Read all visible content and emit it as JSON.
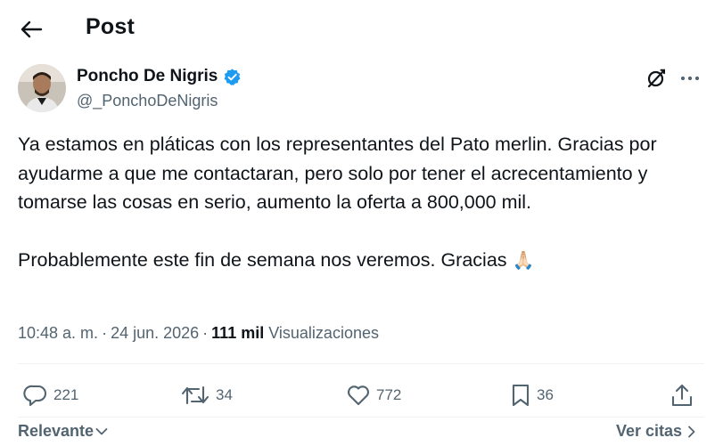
{
  "header": {
    "title": "Post",
    "back_icon": "arrow-left-icon"
  },
  "author": {
    "display_name": "Poncho De Nigris",
    "handle": "@_PonchoDeNigris",
    "verified_color": "#1d9bf0",
    "verified_icon": "verified-badge-icon"
  },
  "post": {
    "paragraph1": "Ya estamos en pláticas con los representantes del Pato merlin. Gracias por ayudarme a que me contactaran, pero solo por tener el acrecentamiento y tomarse las cosas en serio, aumento la oferta a 800,000 mil.",
    "paragraph2": "Probablemente este fin de semana nos veremos. Gracias",
    "emoji": "🙏🏻"
  },
  "meta": {
    "time": "10:48 a. m.",
    "date": "24 jun. 2026",
    "views_count": "111 mil",
    "views_label": "Visualizaciones"
  },
  "actions": {
    "replies": "221",
    "reposts": "34",
    "likes": "772",
    "bookmarks": "36"
  },
  "footer": {
    "sort_label": "Relevante",
    "quotes_label": "Ver citas"
  },
  "colors": {
    "text": "#0f1419",
    "secondary": "#536471",
    "accent": "#1d9bf0",
    "divider": "#eff3f4"
  }
}
